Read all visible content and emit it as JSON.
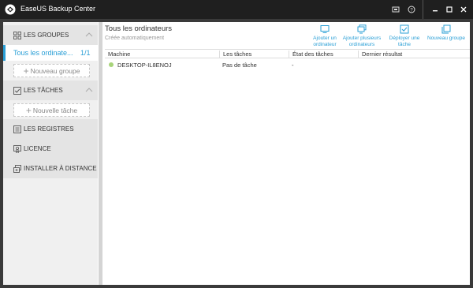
{
  "app": {
    "title": "EaseUS Backup Center"
  },
  "sidebar": {
    "groups_section": {
      "label": "LES GROUPES"
    },
    "group_items": [
      {
        "label": "Tous les ordinate...",
        "count": "1/1"
      }
    ],
    "new_group_label": "Nouveau groupe",
    "tasks_section": {
      "label": "LES TÂCHES"
    },
    "new_task_label": "Nouvelle tâche",
    "registers_section": {
      "label": "LES REGISTRES"
    },
    "licence_section": {
      "label": "LICENCE"
    },
    "remote_install_section": {
      "label": "INSTALLER À DISTANCE"
    }
  },
  "main": {
    "title": "Tous les ordinateurs",
    "subtitle": "Créée automatiquement",
    "actions": {
      "add_one": {
        "line1": "Ajouter un",
        "line2": "ordinateur"
      },
      "add_many": {
        "line1": "Ajouter plusieurs",
        "line2": "ordinateurs"
      },
      "deploy": {
        "line1": "Déployer une",
        "line2": "tâche"
      },
      "new_group": {
        "line1": "Nouveau groupe",
        "line2": ""
      }
    },
    "table": {
      "columns": [
        "Machine",
        "Les tâches",
        "État des tâches",
        "Dernier résultat"
      ],
      "rows": [
        {
          "machine": "DESKTOP-IL8ENOJ",
          "tasks": "Pas de tâche",
          "status": "-",
          "result": ""
        }
      ]
    }
  },
  "colors": {
    "accent": "#2a9fd6",
    "titlebar": "#1f1f1f",
    "online_dot": "#a8d47a"
  }
}
